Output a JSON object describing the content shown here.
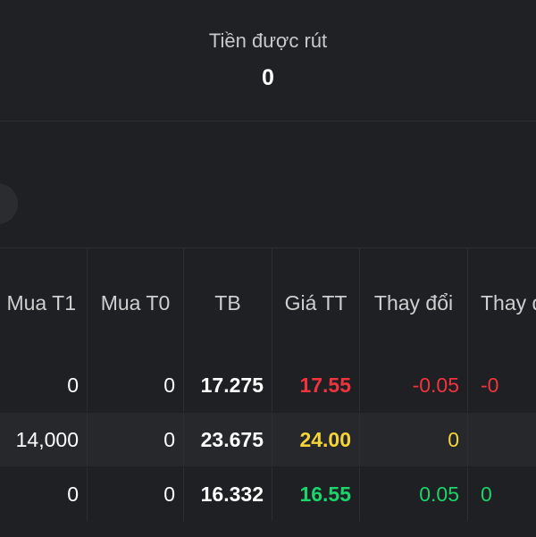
{
  "summary": {
    "label": "Tiền được rút",
    "value": "0"
  },
  "table": {
    "headers": [
      "Mua T1",
      "Mua T0",
      "TB",
      "Giá TT",
      "Thay đổi",
      "Thay đổi"
    ],
    "rows": [
      {
        "mua_t1": "0",
        "mua_t0": "0",
        "tb": "17.275",
        "gia_tt": "17.55",
        "thay_doi": "-0.05",
        "thay_doi_pct": "-0",
        "status": "down"
      },
      {
        "mua_t1": "14,000",
        "mua_t0": "0",
        "tb": "23.675",
        "gia_tt": "24.00",
        "thay_doi": "0",
        "thay_doi_pct": "",
        "status": "unchanged"
      },
      {
        "mua_t1": "0",
        "mua_t0": "0",
        "tb": "16.332",
        "gia_tt": "16.55",
        "thay_doi": "0.05",
        "thay_doi_pct": "0",
        "status": "up"
      }
    ]
  },
  "colors": {
    "down": "#f0343f",
    "unchanged": "#f5d43a",
    "up": "#1bd46b"
  }
}
